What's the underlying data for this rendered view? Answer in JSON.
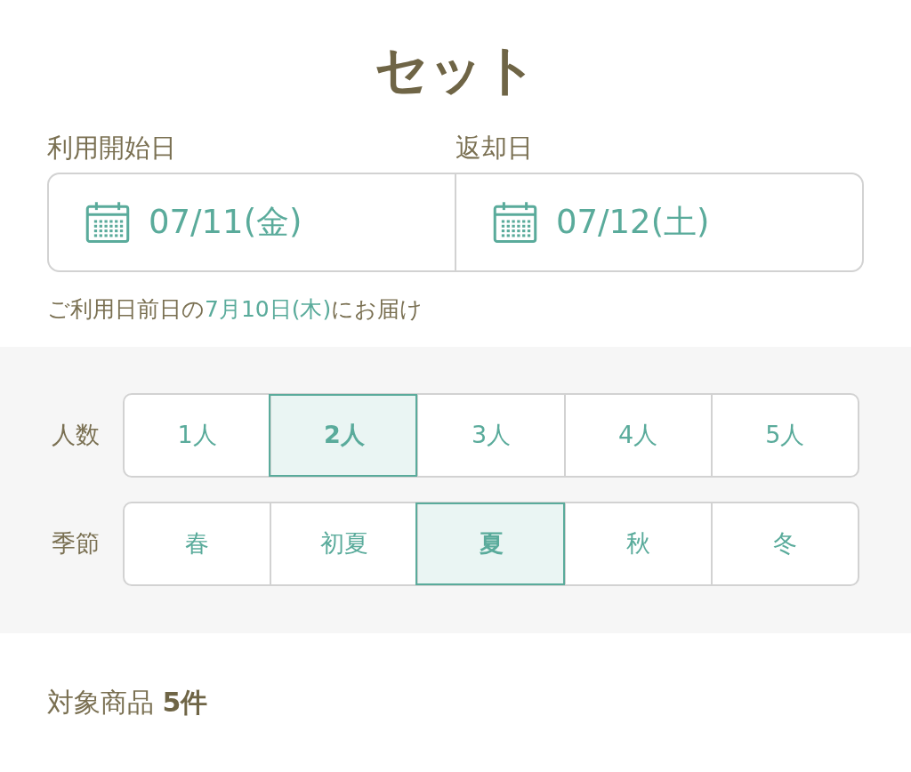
{
  "title": "セット",
  "dates": [
    {
      "label": "利用開始日",
      "value": "07/11(金)"
    },
    {
      "label": "返却日",
      "value": "07/12(土)"
    }
  ],
  "delivery_note": {
    "prefix": "ご利用日前日の",
    "date": "7月10日(木)",
    "suffix": "にお届け"
  },
  "selectors": [
    {
      "label": "人数",
      "options": [
        {
          "label": "1人",
          "selected": false
        },
        {
          "label": "2人",
          "selected": true
        },
        {
          "label": "3人",
          "selected": false
        },
        {
          "label": "4人",
          "selected": false
        },
        {
          "label": "5人",
          "selected": false
        }
      ]
    },
    {
      "label": "季節",
      "options": [
        {
          "label": "春",
          "selected": false
        },
        {
          "label": "初夏",
          "selected": false
        },
        {
          "label": "夏",
          "selected": true
        },
        {
          "label": "秋",
          "selected": false
        },
        {
          "label": "冬",
          "selected": false
        }
      ]
    }
  ],
  "results": {
    "label": "対象商品",
    "count": "5件"
  }
}
